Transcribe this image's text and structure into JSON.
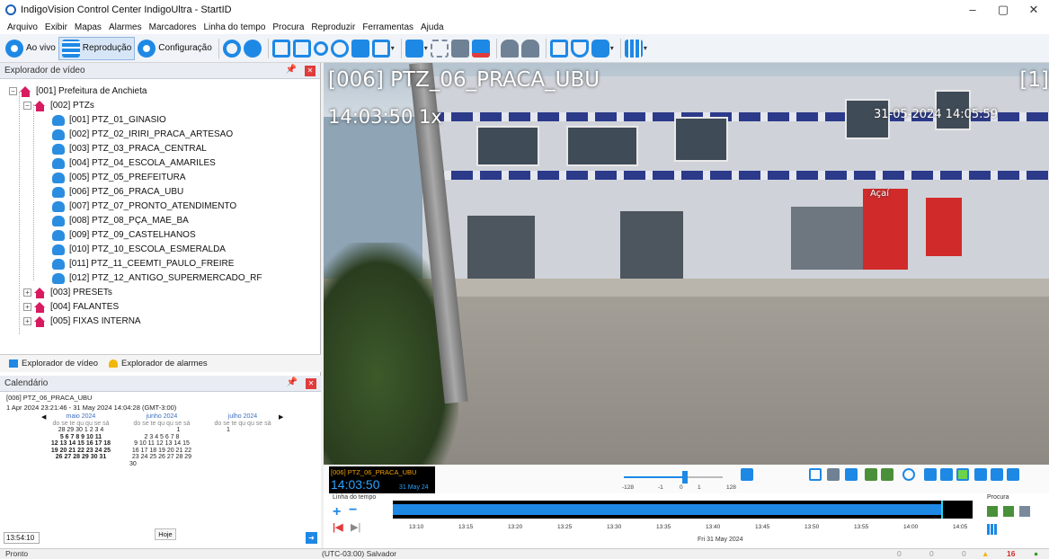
{
  "window": {
    "title": "IndigoVision Control Center IndigoUltra - StartID",
    "minimize": "–",
    "maximize": "▢",
    "close": "✕"
  },
  "menu": [
    "Arquivo",
    "Exibir",
    "Mapas",
    "Alarmes",
    "Marcadores",
    "Linha do tempo",
    "Procura",
    "Reproduzir",
    "Ferramentas",
    "Ajuda"
  ],
  "toolbar": {
    "live_label": "Ao vivo",
    "playback_label": "Reprodução",
    "config_label": "Configuração"
  },
  "explorer": {
    "title": "Explorador de vídeo",
    "tree": [
      {
        "label": "[001] Prefeitura de Anchieta",
        "type": "site"
      },
      {
        "label": "[002] PTZs",
        "type": "site"
      },
      {
        "label": "[001] PTZ_01_GINASIO",
        "type": "camera"
      },
      {
        "label": "[002] PTZ_02_IRIRI_PRACA_ARTESAO",
        "type": "camera"
      },
      {
        "label": "[003] PTZ_03_PRACA_CENTRAL",
        "type": "camera"
      },
      {
        "label": "[004] PTZ_04_ESCOLA_AMARILES",
        "type": "camera"
      },
      {
        "label": "[005] PTZ_05_PREFEITURA",
        "type": "camera"
      },
      {
        "label": "[006] PTZ_06_PRACA_UBU",
        "type": "camera"
      },
      {
        "label": "[007] PTZ_07_PRONTO_ATENDIMENTO",
        "type": "camera"
      },
      {
        "label": "[008] PTZ_08_PÇA_MAE_BA",
        "type": "camera"
      },
      {
        "label": "[009] PTZ_09_CASTELHANOS",
        "type": "camera"
      },
      {
        "label": "[010] PTZ_10_ESCOLA_ESMERALDA",
        "type": "camera"
      },
      {
        "label": "[011] PTZ_11_CEEMTI_PAULO_FREIRE",
        "type": "camera"
      },
      {
        "label": "[012] PTZ_12_ANTIGO_SUPERMERCADO_RF",
        "type": "camera"
      },
      {
        "label": "[003] PRESETs",
        "type": "site"
      },
      {
        "label": "[004] FALANTES",
        "type": "site"
      },
      {
        "label": "[005] FIXAS INTERNA",
        "type": "site"
      }
    ],
    "tab_video": "Explorador de vídeo",
    "tab_alarms": "Explorador de alarmes"
  },
  "calendar": {
    "title": "Calendário",
    "camera": "[006] PTZ_06_PRACA_UBU",
    "range": "1 Apr 2024 23:21:46 - 31 May 2024 14:04:28 (GMT-3:00)",
    "months": [
      {
        "name": "maio 2024",
        "days_header": "do se te qu qu se sá",
        "rows": [
          "28 29 30  1  2  3  4",
          " 5  6  7  8  9 10 11",
          "12 13 14 15 16 17 18",
          "19 20 21 22 23 24 25",
          "26 27 28 29 30 31"
        ]
      },
      {
        "name": "junho 2024",
        "days_header": "do se te qu qu se sá",
        "rows": [
          "                   1",
          " 2  3  4  5  6  7  8",
          " 9 10 11 12 13 14 15",
          "16 17 18 19 20 21 22",
          "23 24 25 26 27 28 29",
          "30"
        ]
      },
      {
        "name": "julho 2024",
        "days_header": "do se te qu qu se sá",
        "rows": [
          " 1"
        ]
      }
    ],
    "today_label": "Hoje",
    "time": "13:54:10"
  },
  "video": {
    "camera_title": "[006] PTZ_06_PRACA_UBU",
    "time_overlay": "14:03:50 1x",
    "date_overlay": "31-05-2024 14:05:59",
    "panel_index": "[1]",
    "shop_sign": "Açaí"
  },
  "playback": {
    "clock_name": "[006] PTZ_06_PRACA_UBU",
    "clock_time": "14:03:50",
    "clock_date": "31 May 24",
    "speed_labels": [
      "-128",
      "-1",
      "0",
      "1",
      "128"
    ],
    "speed_value": 1,
    "timeline_label": "Linha do tempo",
    "search_label": "Procura",
    "ticks": [
      "13:10",
      "13:15",
      "13:20",
      "13:25",
      "13:30",
      "13:35",
      "13:40",
      "13:45",
      "13:50",
      "13:55",
      "14:00",
      "14:05"
    ],
    "date_label": "Fri 31 May 2024"
  },
  "status": {
    "left": "Pronto",
    "timezone": "(UTC-03:00) Salvador",
    "count_a": "0",
    "count_b": "0",
    "count_c": "0",
    "alarms": "16"
  }
}
